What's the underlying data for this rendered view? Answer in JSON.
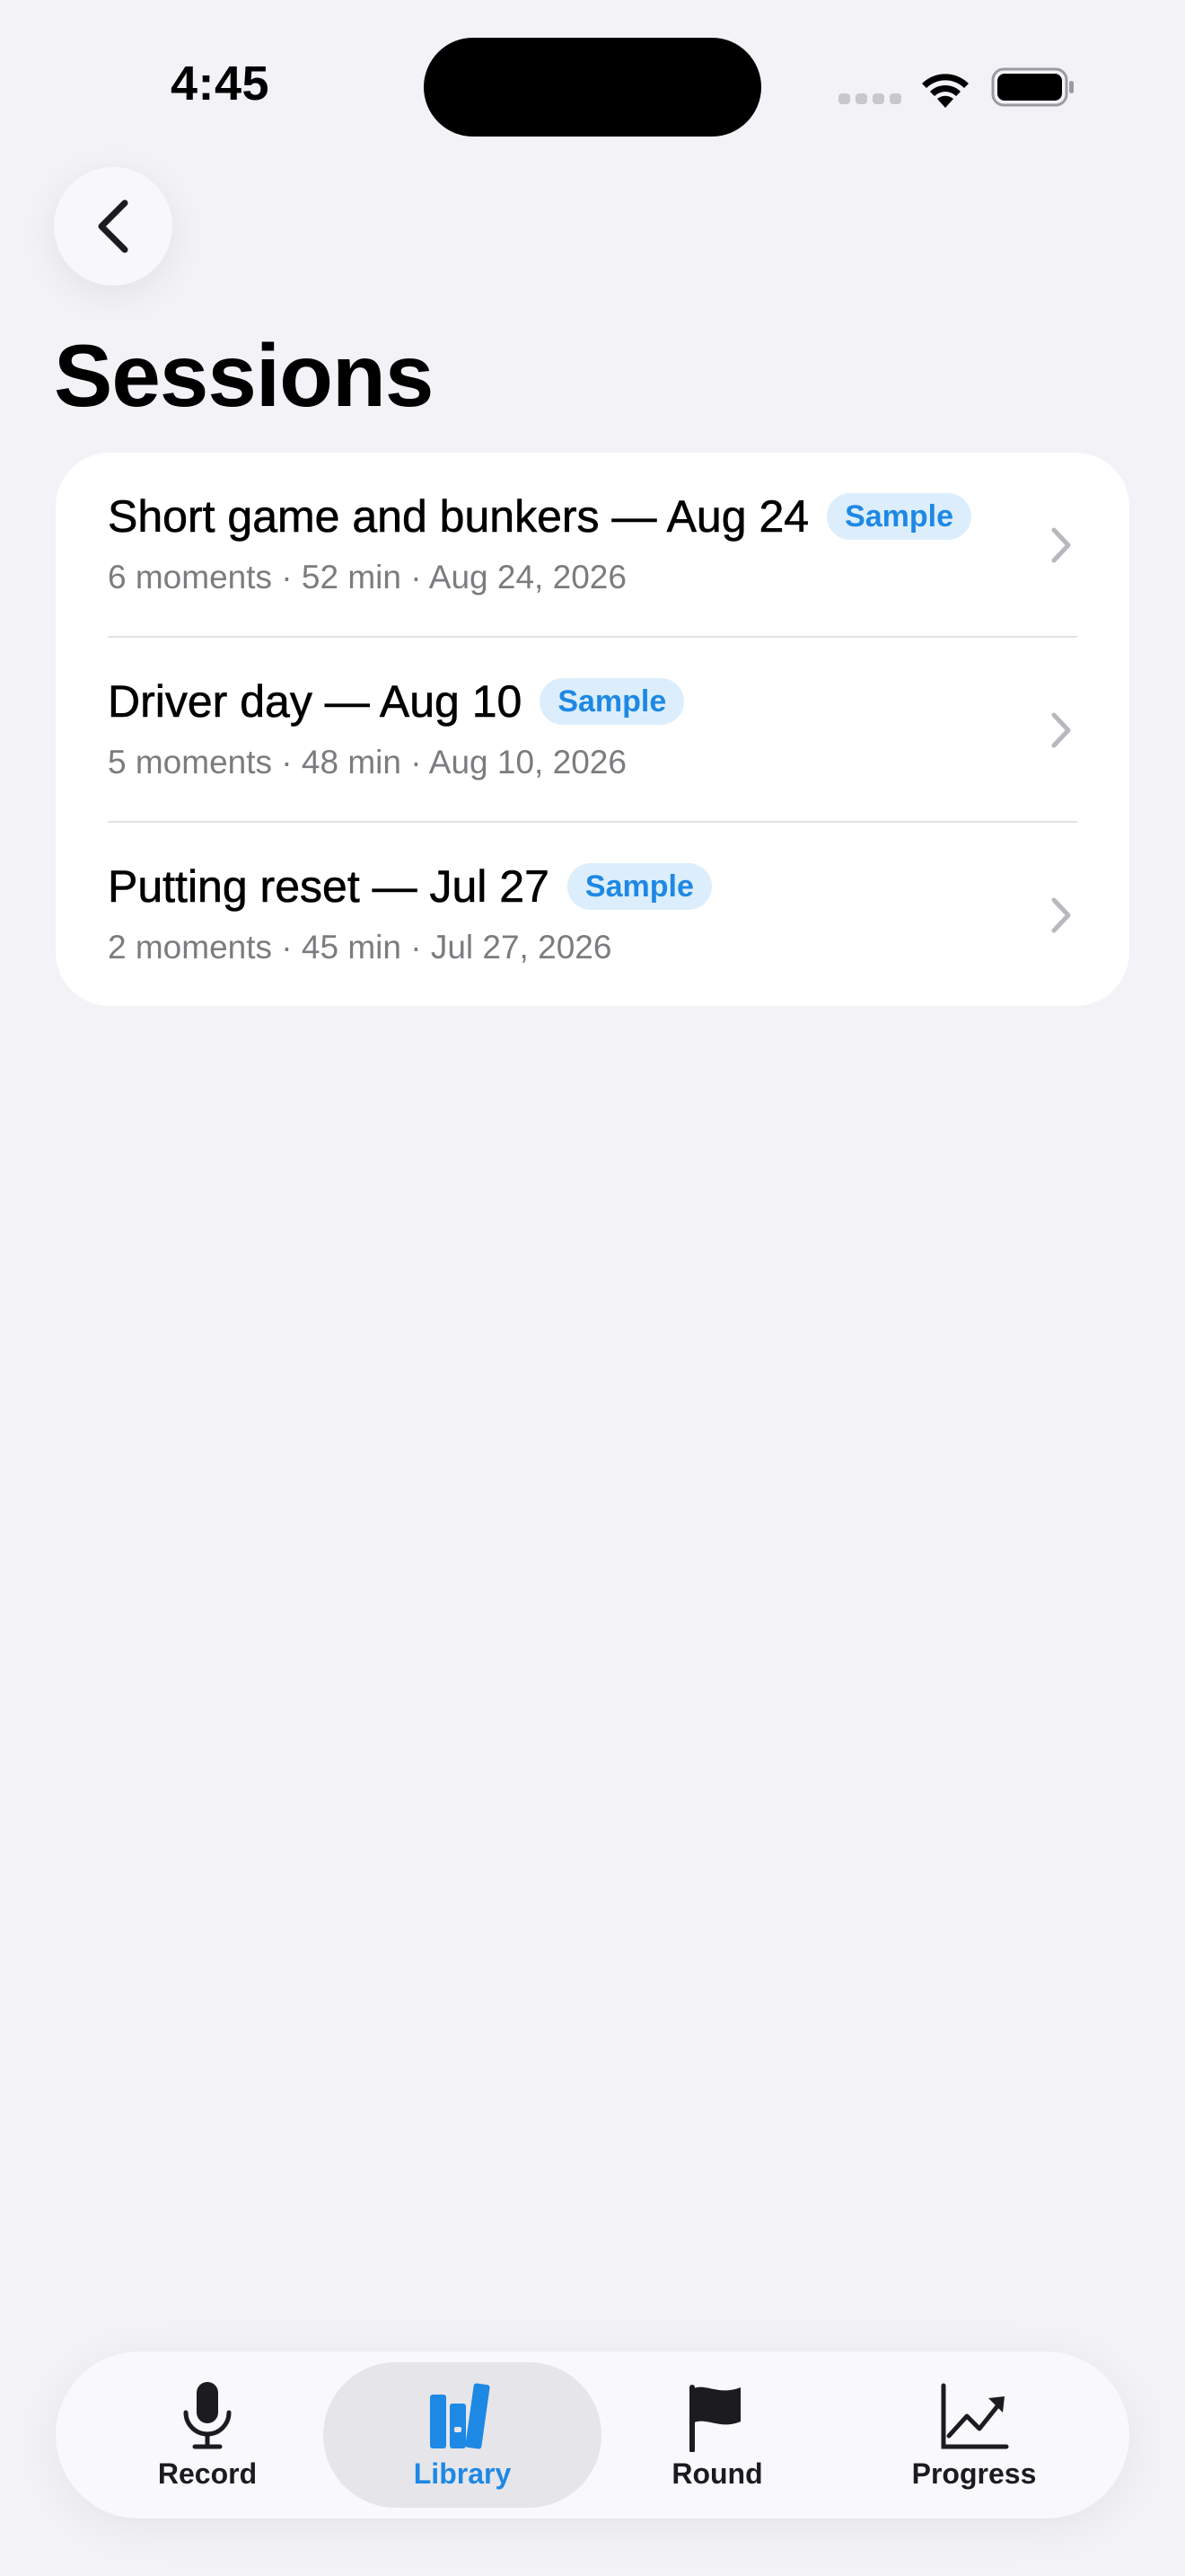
{
  "status_bar": {
    "time": "4:45"
  },
  "nav": {
    "title": "Sessions",
    "back_icon": "chevron-left-icon"
  },
  "sessions": [
    {
      "title": "Short game and bunkers — Aug 24",
      "badge": "Sample",
      "meta": "6 moments · 52 min · Aug 24, 2026"
    },
    {
      "title": "Driver day — Aug 10",
      "badge": "Sample",
      "meta": "5 moments · 48 min · Aug 10, 2026"
    },
    {
      "title": "Putting reset — Jul 27",
      "badge": "Sample",
      "meta": "2 moments · 45 min · Jul 27, 2026"
    }
  ],
  "tabs": [
    {
      "label": "Record",
      "icon": "microphone-icon",
      "active": false
    },
    {
      "label": "Library",
      "icon": "books-icon",
      "active": true
    },
    {
      "label": "Round",
      "icon": "flag-icon",
      "active": false
    },
    {
      "label": "Progress",
      "icon": "chart-line-icon",
      "active": false
    }
  ],
  "colors": {
    "accent": "#1E88E5",
    "badge_bg": "#DCEEFB",
    "background": "#F2F2F7"
  }
}
